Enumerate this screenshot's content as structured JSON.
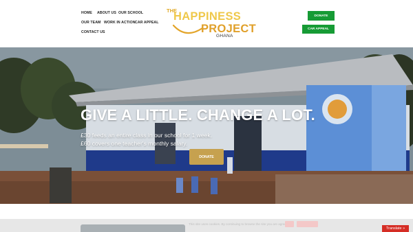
{
  "nav": {
    "items": [
      {
        "label": "HOME"
      },
      {
        "label": "ABOUT US"
      },
      {
        "label": "OUR SCHOOL"
      },
      {
        "label": "OUR TEAM"
      },
      {
        "label": "WORK IN ACTION"
      },
      {
        "label": "CAR APPEAL"
      },
      {
        "label": "CONTACT US"
      }
    ]
  },
  "logo": {
    "the": "THE",
    "happiness": "HAPPINESS",
    "project": "PROJECT",
    "ghana": "GHANA"
  },
  "header_buttons": {
    "donate": "DONATE",
    "car_appeal": "CAR APPEAL"
  },
  "hero": {
    "title": "GIVE A LITTLE. CHANGE A LOT.",
    "line1": "£30 feeds an entire class in our school for 1 week.",
    "line2": "£60 covers one teacher's monthly salary.",
    "button": "DONATE"
  },
  "cookie": {
    "text": "This site uses cookies. By continuing to browse the site you are agreeing"
  },
  "translate": {
    "label": "Translate »"
  },
  "colors": {
    "green": "#169b35",
    "gold": "#c6a14f",
    "logo_yellow": "#efc84a",
    "translate_red": "#d52d25"
  }
}
